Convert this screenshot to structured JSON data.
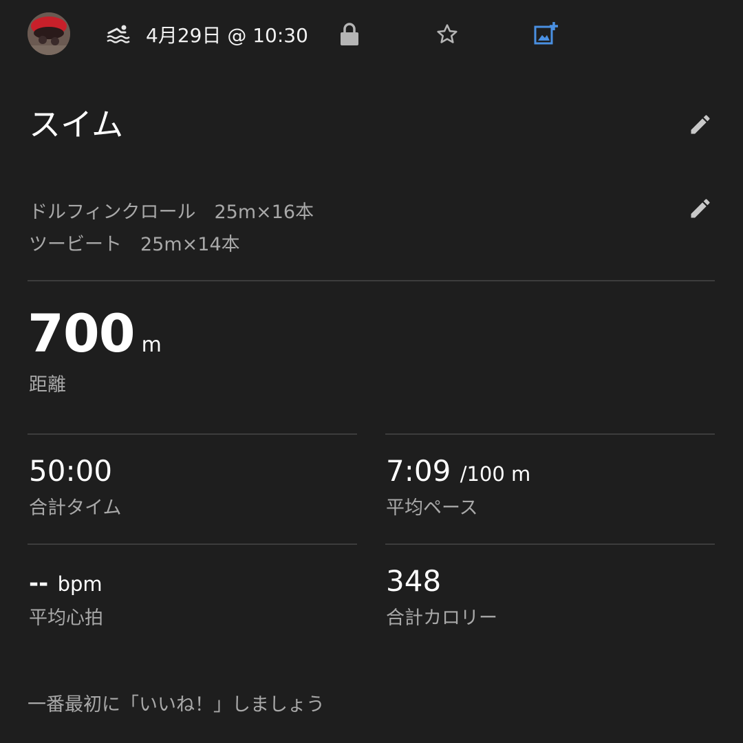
{
  "header": {
    "date_time": "4月29日 @ 10:30",
    "activity_icon": "swim-icon",
    "privacy_icon": "lock-icon",
    "favorite_icon": "star-outline-icon",
    "add_photo_icon": "add-photo-icon",
    "add_photo_color": "#4a90e2"
  },
  "activity": {
    "title": "スイム",
    "description": [
      "ドルフィンクロール　25m×16本",
      "ツービート　25m×14本"
    ]
  },
  "stats": {
    "distance": {
      "value": "700",
      "unit": "m",
      "label": "距離"
    },
    "total_time": {
      "value": "50:00",
      "label": "合計タイム"
    },
    "avg_pace": {
      "value": "7:09",
      "unit": "/100 m",
      "label": "平均ペース"
    },
    "avg_heart_rate": {
      "value": "--",
      "unit": "bpm",
      "label": "平均心拍"
    },
    "total_calories": {
      "value": "348",
      "label": "合計カロリー"
    }
  },
  "like_prompt": "一番最初に「いいね！」しましょう"
}
